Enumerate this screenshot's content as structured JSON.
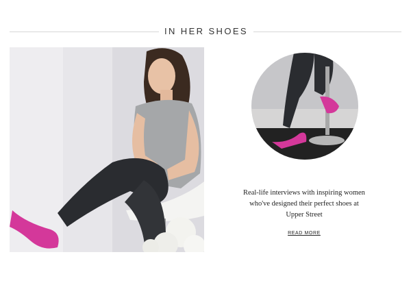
{
  "section": {
    "title": "IN HER SHOES"
  },
  "feature": {
    "hero_image": "woman-seated-pink-heels-photo",
    "circle_image": "pink-heels-closeup-photo",
    "blurb": "Real-life interviews with inspiring women who've designed their perfect shoes at Upper Street",
    "read_more_label": "READ MORE"
  },
  "colors": {
    "shoe_pink": "#d4389a",
    "leggings": "#2a2c30",
    "rule": "#d6d6d6"
  }
}
